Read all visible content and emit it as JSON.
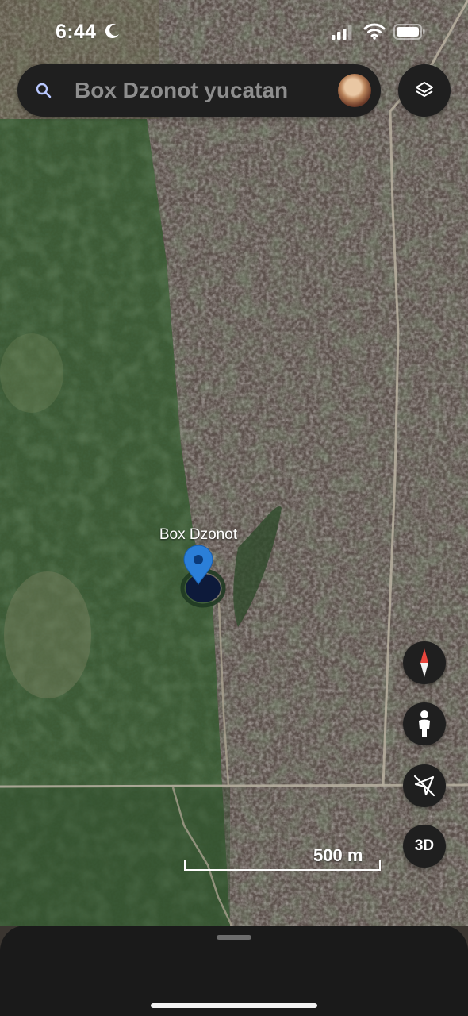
{
  "status_bar": {
    "time": "6:44",
    "moon_icon": "moon-icon",
    "signal_icon": "cellular-signal-icon",
    "wifi_icon": "wifi-icon",
    "battery_icon": "battery-icon"
  },
  "search": {
    "query": "Box Dzonot yucatan",
    "search_icon": "search-icon",
    "avatar": "user-avatar"
  },
  "layers_icon": "layers-icon",
  "place": {
    "label": "Box Dzonot",
    "pin_color": "#2b7fd8"
  },
  "controls": {
    "compass_icon": "compass-icon",
    "pegman_icon": "street-view-pegman-icon",
    "location_icon": "location-arrow-off-icon",
    "three_d_label": "3D"
  },
  "scale": {
    "label": "500 m"
  },
  "colors": {
    "pin_blue": "#2b7fd8",
    "panel_dark": "#1f1f1f",
    "compass_red": "#e8453c"
  }
}
